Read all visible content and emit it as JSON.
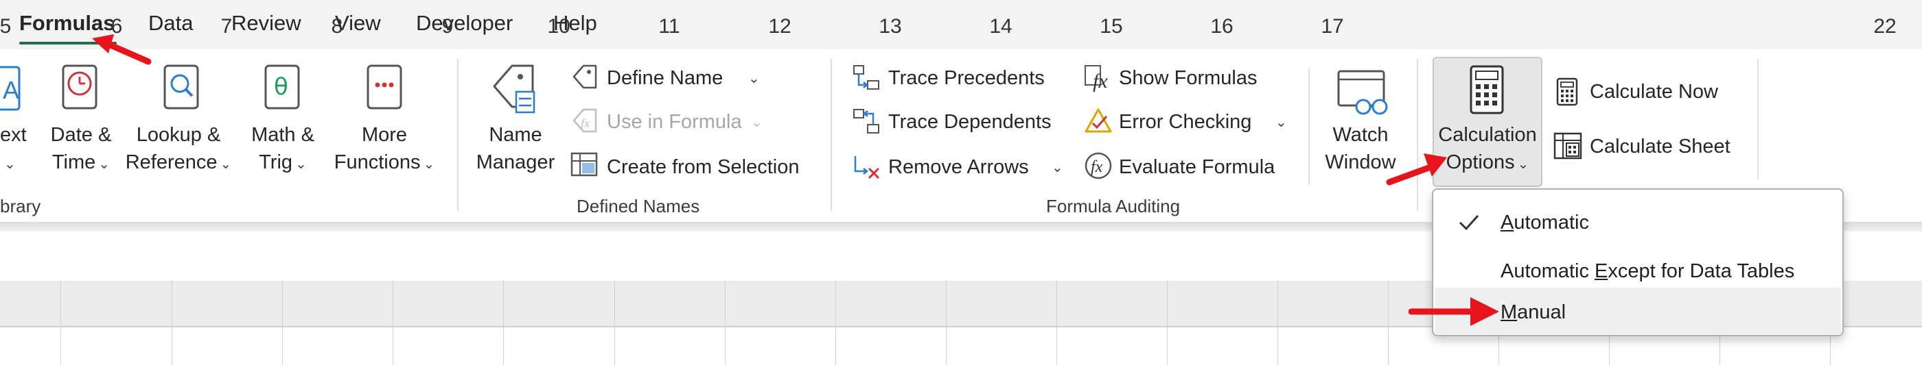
{
  "tabs": [
    {
      "label": "Formulas",
      "active": true
    },
    {
      "label": "Data"
    },
    {
      "label": "Review"
    },
    {
      "label": "View"
    },
    {
      "label": "Developer"
    },
    {
      "label": "Help"
    }
  ],
  "ribbon": {
    "function_library": {
      "group_label": "brary",
      "text_label": "ext",
      "date_time": {
        "line1": "Date &",
        "line2": "Time"
      },
      "lookup": {
        "line1": "Lookup &",
        "line2": "Reference"
      },
      "math": {
        "line1": "Math &",
        "line2": "Trig"
      },
      "more": {
        "line1": "More",
        "line2": "Functions"
      }
    },
    "defined_names": {
      "group_label": "Defined Names",
      "name_manager": {
        "line1": "Name",
        "line2": "Manager"
      },
      "define_name": "Define Name",
      "use_in_formula": "Use in Formula",
      "create_from_selection": "Create from Selection"
    },
    "formula_auditing": {
      "group_label": "Formula Auditing",
      "trace_precedents": "Trace Precedents",
      "trace_dependents": "Trace Dependents",
      "remove_arrows": "Remove Arrows",
      "show_formulas": "Show Formulas",
      "error_checking": "Error Checking",
      "evaluate_formula": "Evaluate Formula",
      "watch_window": {
        "line1": "Watch",
        "line2": "Window"
      }
    },
    "calculation": {
      "calc_options": {
        "line1": "Calculation",
        "line2": "Options"
      },
      "calculate_now": "Calculate Now",
      "calculate_sheet": "Calculate Sheet"
    }
  },
  "columns": [
    "5",
    "6",
    "7",
    "8",
    "9",
    "10",
    "11",
    "12",
    "13",
    "14",
    "15",
    "16",
    "17",
    "22"
  ],
  "dropdown": {
    "items": [
      {
        "label": "Automatic",
        "checked": true
      },
      {
        "label": "Automatic Except for Data Tables",
        "checked": false
      },
      {
        "label": "Manual",
        "checked": false,
        "hovered": true
      }
    ]
  },
  "colors": {
    "accent_green": "#1e7145",
    "annotation_red": "#e8141c"
  }
}
